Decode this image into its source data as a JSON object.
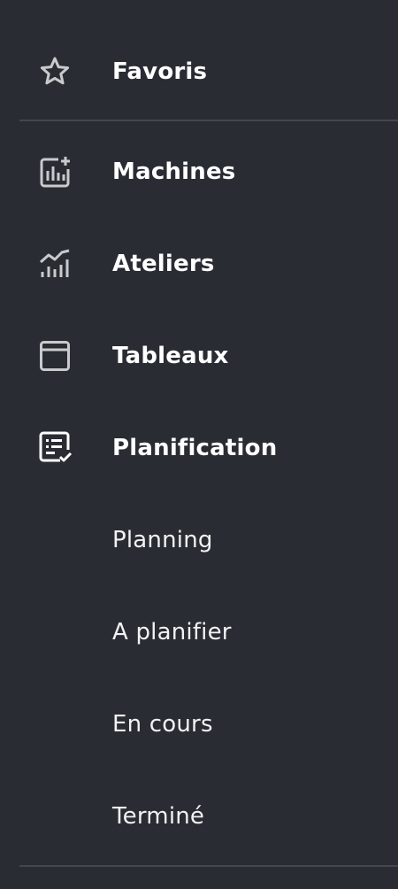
{
  "sidebar": {
    "favorites": {
      "label": "Favoris",
      "icon": "star-icon"
    },
    "items": [
      {
        "label": "Machines",
        "icon": "chart-add-icon"
      },
      {
        "label": "Ateliers",
        "icon": "trend-chart-icon"
      },
      {
        "label": "Tableaux",
        "icon": "window-icon"
      },
      {
        "label": "Planification",
        "icon": "checklist-icon"
      }
    ],
    "planning_subitems": [
      {
        "label": "Planning"
      },
      {
        "label": "A planifier"
      },
      {
        "label": "En cours"
      },
      {
        "label": "Terminé"
      }
    ]
  },
  "colors": {
    "background": "#292c33",
    "icon": "#c9cacc",
    "divider": "#44474d",
    "text": "#ffffff"
  }
}
